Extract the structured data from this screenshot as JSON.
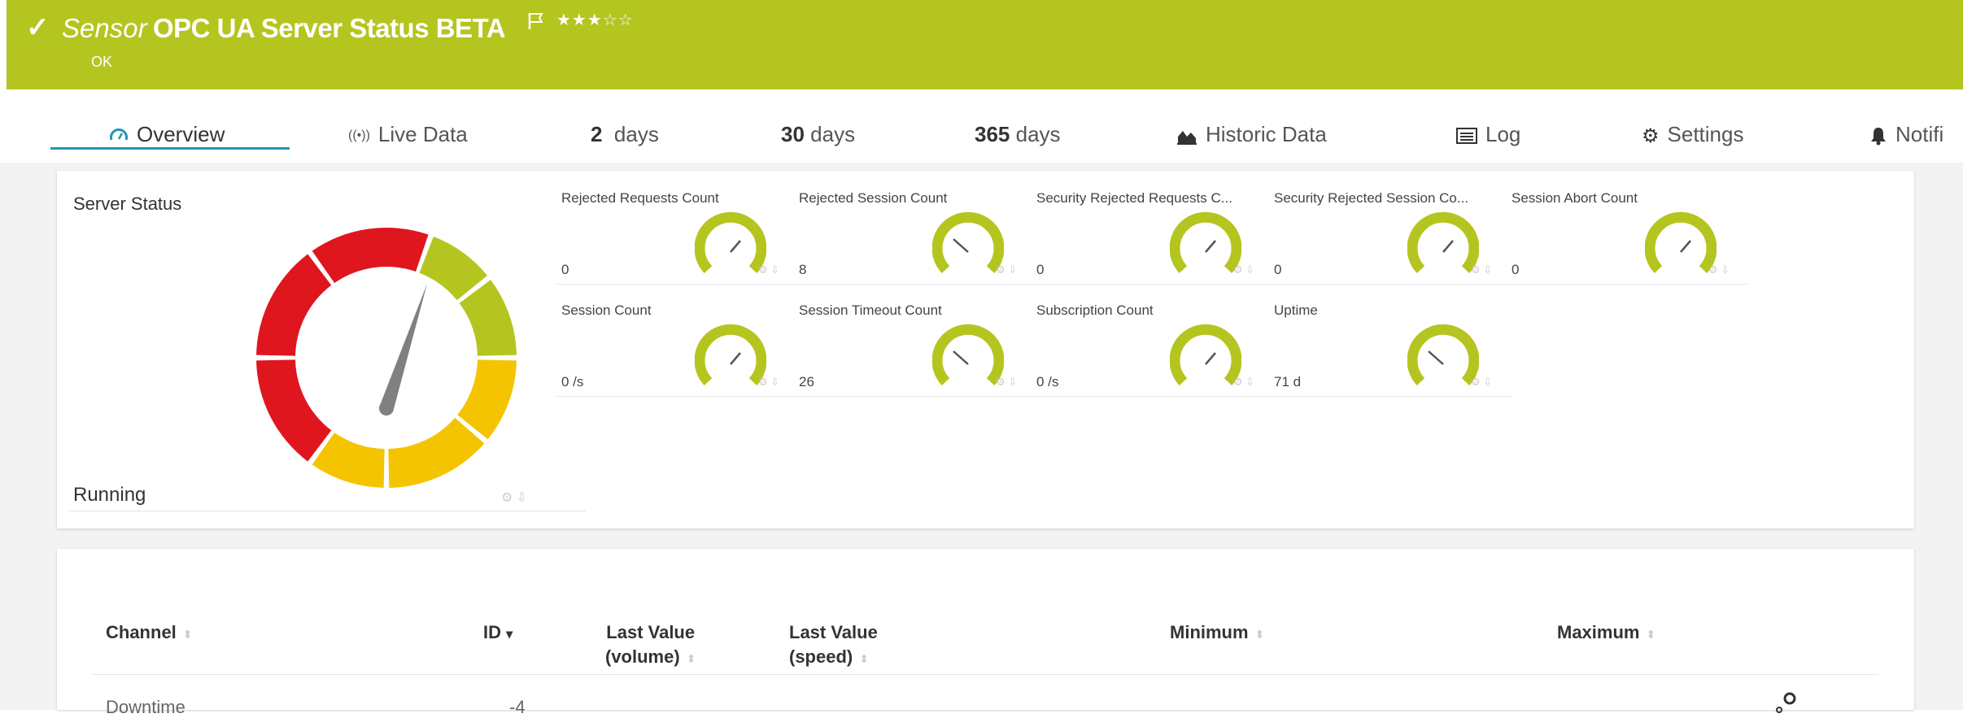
{
  "header": {
    "check": "✓",
    "prefix": "Sensor",
    "name": "OPC UA Server Status BETA",
    "stars": "★★★☆☆",
    "status": "OK",
    "bg_color": "#b4c520"
  },
  "tabs": [
    {
      "label": "Overview",
      "icon": "gauge-icon"
    },
    {
      "label": "Live Data",
      "icon": "broadcast-icon",
      "prefix": "((•))"
    },
    {
      "num": "2",
      "label": "days"
    },
    {
      "num": "30",
      "label": "days"
    },
    {
      "num": "365",
      "label": "days"
    },
    {
      "label": "Historic Data",
      "icon": "area-chart-icon"
    },
    {
      "label": "Log",
      "icon": "list-icon"
    },
    {
      "label": "Settings",
      "icon": "gear-icon"
    },
    {
      "label": "Notifi",
      "icon": "bell-icon"
    }
  ],
  "server": {
    "title": "Server Status",
    "value": "Running"
  },
  "channels": [
    {
      "label": "Rejected Requests Count",
      "value": "0"
    },
    {
      "label": "Rejected Session Count",
      "value": "8"
    },
    {
      "label": "Security Rejected Requests C...",
      "value": "0"
    },
    {
      "label": "Security Rejected Session Co...",
      "value": "0"
    },
    {
      "label": "Session Abort Count",
      "value": "0"
    },
    {
      "label": "Session Count",
      "value": "0 /s"
    },
    {
      "label": "Session Timeout Count",
      "value": "26"
    },
    {
      "label": "Subscription Count",
      "value": "0 /s"
    },
    {
      "label": "Uptime",
      "value": "71 d"
    }
  ],
  "table": {
    "headers": {
      "channel": "Channel",
      "id": "ID",
      "id_sort": "▾",
      "last_volume_1": "Last Value",
      "last_volume_2": "(volume)",
      "last_speed_1": "Last Value",
      "last_speed_2": "(speed)",
      "minimum": "Minimum",
      "maximum": "Maximum"
    },
    "rows": [
      {
        "channel": "Downtime",
        "id": "-4"
      }
    ]
  },
  "colors": {
    "accent": "#b4c520",
    "tab_underline": "#2196b5",
    "red": "#e0161e",
    "yellow": "#f5c400"
  }
}
